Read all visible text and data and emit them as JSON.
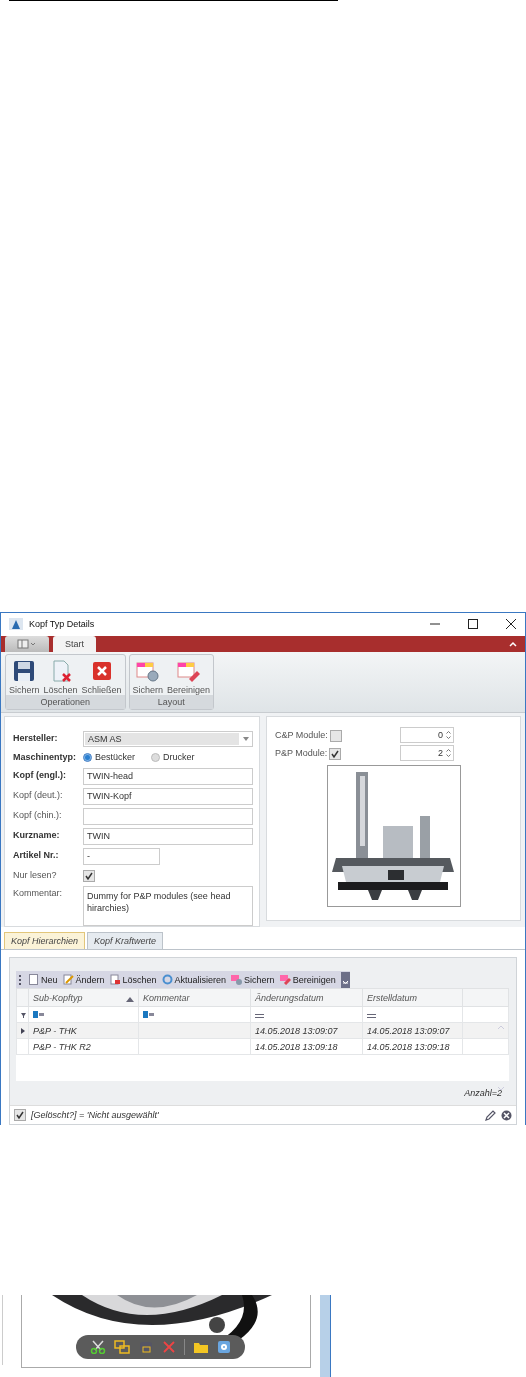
{
  "window": {
    "title": "Kopf Typ Details"
  },
  "ribbon": {
    "tabs": [
      {
        "label": "Start",
        "selected": true
      }
    ],
    "groups": [
      {
        "label": "Operationen",
        "buttons": [
          {
            "label": "Sichern",
            "kind": "save"
          },
          {
            "label": "Löschen",
            "kind": "delete"
          },
          {
            "label": "Schließen",
            "kind": "close"
          }
        ]
      },
      {
        "label": "Layout",
        "buttons": [
          {
            "label": "Sichern",
            "kind": "layout-save"
          },
          {
            "label": "Bereinigen",
            "kind": "layout-clear"
          }
        ]
      }
    ]
  },
  "form": {
    "fields": [
      {
        "label": "Hersteller:",
        "required": true,
        "kind": "dropdown",
        "value": "ASM AS"
      },
      {
        "label": "Maschinentyp:",
        "required": true,
        "kind": "radio",
        "options": [
          {
            "label": "Bestücker",
            "selected": true
          },
          {
            "label": "Drucker",
            "selected": false
          }
        ]
      },
      {
        "label": "Kopf (engl.):",
        "required": true,
        "kind": "text",
        "value": "TWIN-head"
      },
      {
        "label": "Kopf (deut.):",
        "required": false,
        "kind": "text",
        "value": "TWIN-Kopf"
      },
      {
        "label": "Kopf (chin.):",
        "required": false,
        "kind": "text"
      },
      {
        "label": "Kurzname:",
        "required": true,
        "kind": "text",
        "value": "TWIN"
      },
      {
        "label": "Artikel Nr.:",
        "required": true,
        "kind": "short",
        "value": "-"
      },
      {
        "label": "Nur lesen?",
        "required": false,
        "kind": "checkbox",
        "checked": true
      },
      {
        "label": "Kommentar:",
        "required": false,
        "kind": "textarea",
        "value": "Dummy for P&P modules (see head hirarchies)"
      }
    ]
  },
  "modules": [
    {
      "label": "C&P Module:",
      "checked": false,
      "value": "0"
    },
    {
      "label": "P&P Module:",
      "checked": true,
      "value": "2"
    }
  ],
  "tabs": [
    {
      "label": "Kopf Hierarchien",
      "selected": true
    },
    {
      "label": "Kopf Kraftwerte",
      "selected": false
    }
  ],
  "toolbar": [
    {
      "label": "Neu",
      "kind": "new"
    },
    {
      "label": "Ändern",
      "kind": "edit"
    },
    {
      "label": "Löschen",
      "kind": "delete"
    },
    {
      "label": "Aktualisieren",
      "kind": "refresh"
    },
    {
      "label": "Sichern",
      "kind": "save"
    },
    {
      "label": "Bereinigen",
      "kind": "clear"
    }
  ],
  "table": {
    "columns": [
      {
        "label": "Sub-Kopftyp",
        "sorted": true,
        "kind": "text"
      },
      {
        "label": "Kommentar",
        "sorted": false,
        "kind": "text"
      },
      {
        "label": "Änderungsdatum",
        "sorted": false,
        "kind": "date"
      },
      {
        "label": "Erstelldatum",
        "sorted": false,
        "kind": "date"
      }
    ],
    "rows": [
      {
        "selected": true,
        "cells": [
          "P&P - THK",
          "",
          "14.05.2018 13:09:07",
          "14.05.2018 13:09:07"
        ]
      },
      {
        "selected": false,
        "cells": [
          "P&P - THK R2",
          "",
          "14.05.2018 13:09:18",
          "14.05.2018 13:09:18"
        ]
      }
    ],
    "count": "Anzahl=2"
  },
  "filter_bar": {
    "checked": true,
    "text": "[Gelöscht?] = 'Nicht ausgewählt'"
  }
}
